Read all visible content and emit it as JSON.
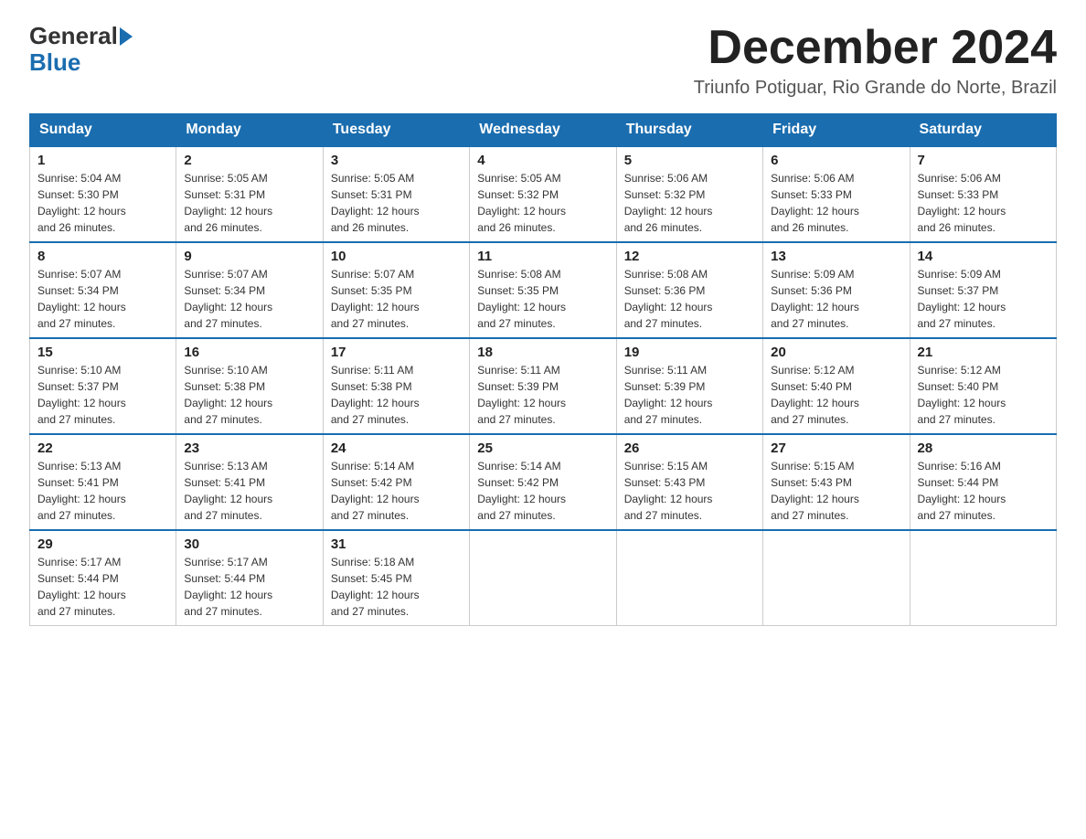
{
  "header": {
    "logo_general": "General",
    "logo_blue": "Blue",
    "month_title": "December 2024",
    "subtitle": "Triunfo Potiguar, Rio Grande do Norte, Brazil"
  },
  "days_of_week": [
    "Sunday",
    "Monday",
    "Tuesday",
    "Wednesday",
    "Thursday",
    "Friday",
    "Saturday"
  ],
  "weeks": [
    [
      {
        "day": "1",
        "sunrise": "Sunrise: 5:04 AM",
        "sunset": "Sunset: 5:30 PM",
        "daylight": "Daylight: 12 hours",
        "daylight2": "and 26 minutes."
      },
      {
        "day": "2",
        "sunrise": "Sunrise: 5:05 AM",
        "sunset": "Sunset: 5:31 PM",
        "daylight": "Daylight: 12 hours",
        "daylight2": "and 26 minutes."
      },
      {
        "day": "3",
        "sunrise": "Sunrise: 5:05 AM",
        "sunset": "Sunset: 5:31 PM",
        "daylight": "Daylight: 12 hours",
        "daylight2": "and 26 minutes."
      },
      {
        "day": "4",
        "sunrise": "Sunrise: 5:05 AM",
        "sunset": "Sunset: 5:32 PM",
        "daylight": "Daylight: 12 hours",
        "daylight2": "and 26 minutes."
      },
      {
        "day": "5",
        "sunrise": "Sunrise: 5:06 AM",
        "sunset": "Sunset: 5:32 PM",
        "daylight": "Daylight: 12 hours",
        "daylight2": "and 26 minutes."
      },
      {
        "day": "6",
        "sunrise": "Sunrise: 5:06 AM",
        "sunset": "Sunset: 5:33 PM",
        "daylight": "Daylight: 12 hours",
        "daylight2": "and 26 minutes."
      },
      {
        "day": "7",
        "sunrise": "Sunrise: 5:06 AM",
        "sunset": "Sunset: 5:33 PM",
        "daylight": "Daylight: 12 hours",
        "daylight2": "and 26 minutes."
      }
    ],
    [
      {
        "day": "8",
        "sunrise": "Sunrise: 5:07 AM",
        "sunset": "Sunset: 5:34 PM",
        "daylight": "Daylight: 12 hours",
        "daylight2": "and 27 minutes."
      },
      {
        "day": "9",
        "sunrise": "Sunrise: 5:07 AM",
        "sunset": "Sunset: 5:34 PM",
        "daylight": "Daylight: 12 hours",
        "daylight2": "and 27 minutes."
      },
      {
        "day": "10",
        "sunrise": "Sunrise: 5:07 AM",
        "sunset": "Sunset: 5:35 PM",
        "daylight": "Daylight: 12 hours",
        "daylight2": "and 27 minutes."
      },
      {
        "day": "11",
        "sunrise": "Sunrise: 5:08 AM",
        "sunset": "Sunset: 5:35 PM",
        "daylight": "Daylight: 12 hours",
        "daylight2": "and 27 minutes."
      },
      {
        "day": "12",
        "sunrise": "Sunrise: 5:08 AM",
        "sunset": "Sunset: 5:36 PM",
        "daylight": "Daylight: 12 hours",
        "daylight2": "and 27 minutes."
      },
      {
        "day": "13",
        "sunrise": "Sunrise: 5:09 AM",
        "sunset": "Sunset: 5:36 PM",
        "daylight": "Daylight: 12 hours",
        "daylight2": "and 27 minutes."
      },
      {
        "day": "14",
        "sunrise": "Sunrise: 5:09 AM",
        "sunset": "Sunset: 5:37 PM",
        "daylight": "Daylight: 12 hours",
        "daylight2": "and 27 minutes."
      }
    ],
    [
      {
        "day": "15",
        "sunrise": "Sunrise: 5:10 AM",
        "sunset": "Sunset: 5:37 PM",
        "daylight": "Daylight: 12 hours",
        "daylight2": "and 27 minutes."
      },
      {
        "day": "16",
        "sunrise": "Sunrise: 5:10 AM",
        "sunset": "Sunset: 5:38 PM",
        "daylight": "Daylight: 12 hours",
        "daylight2": "and 27 minutes."
      },
      {
        "day": "17",
        "sunrise": "Sunrise: 5:11 AM",
        "sunset": "Sunset: 5:38 PM",
        "daylight": "Daylight: 12 hours",
        "daylight2": "and 27 minutes."
      },
      {
        "day": "18",
        "sunrise": "Sunrise: 5:11 AM",
        "sunset": "Sunset: 5:39 PM",
        "daylight": "Daylight: 12 hours",
        "daylight2": "and 27 minutes."
      },
      {
        "day": "19",
        "sunrise": "Sunrise: 5:11 AM",
        "sunset": "Sunset: 5:39 PM",
        "daylight": "Daylight: 12 hours",
        "daylight2": "and 27 minutes."
      },
      {
        "day": "20",
        "sunrise": "Sunrise: 5:12 AM",
        "sunset": "Sunset: 5:40 PM",
        "daylight": "Daylight: 12 hours",
        "daylight2": "and 27 minutes."
      },
      {
        "day": "21",
        "sunrise": "Sunrise: 5:12 AM",
        "sunset": "Sunset: 5:40 PM",
        "daylight": "Daylight: 12 hours",
        "daylight2": "and 27 minutes."
      }
    ],
    [
      {
        "day": "22",
        "sunrise": "Sunrise: 5:13 AM",
        "sunset": "Sunset: 5:41 PM",
        "daylight": "Daylight: 12 hours",
        "daylight2": "and 27 minutes."
      },
      {
        "day": "23",
        "sunrise": "Sunrise: 5:13 AM",
        "sunset": "Sunset: 5:41 PM",
        "daylight": "Daylight: 12 hours",
        "daylight2": "and 27 minutes."
      },
      {
        "day": "24",
        "sunrise": "Sunrise: 5:14 AM",
        "sunset": "Sunset: 5:42 PM",
        "daylight": "Daylight: 12 hours",
        "daylight2": "and 27 minutes."
      },
      {
        "day": "25",
        "sunrise": "Sunrise: 5:14 AM",
        "sunset": "Sunset: 5:42 PM",
        "daylight": "Daylight: 12 hours",
        "daylight2": "and 27 minutes."
      },
      {
        "day": "26",
        "sunrise": "Sunrise: 5:15 AM",
        "sunset": "Sunset: 5:43 PM",
        "daylight": "Daylight: 12 hours",
        "daylight2": "and 27 minutes."
      },
      {
        "day": "27",
        "sunrise": "Sunrise: 5:15 AM",
        "sunset": "Sunset: 5:43 PM",
        "daylight": "Daylight: 12 hours",
        "daylight2": "and 27 minutes."
      },
      {
        "day": "28",
        "sunrise": "Sunrise: 5:16 AM",
        "sunset": "Sunset: 5:44 PM",
        "daylight": "Daylight: 12 hours",
        "daylight2": "and 27 minutes."
      }
    ],
    [
      {
        "day": "29",
        "sunrise": "Sunrise: 5:17 AM",
        "sunset": "Sunset: 5:44 PM",
        "daylight": "Daylight: 12 hours",
        "daylight2": "and 27 minutes."
      },
      {
        "day": "30",
        "sunrise": "Sunrise: 5:17 AM",
        "sunset": "Sunset: 5:44 PM",
        "daylight": "Daylight: 12 hours",
        "daylight2": "and 27 minutes."
      },
      {
        "day": "31",
        "sunrise": "Sunrise: 5:18 AM",
        "sunset": "Sunset: 5:45 PM",
        "daylight": "Daylight: 12 hours",
        "daylight2": "and 27 minutes."
      },
      null,
      null,
      null,
      null
    ]
  ]
}
